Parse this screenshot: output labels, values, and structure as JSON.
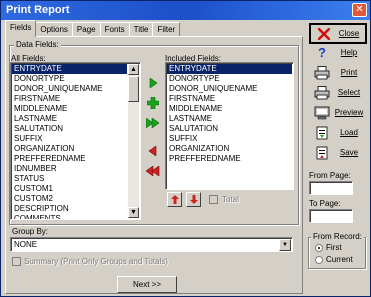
{
  "window": {
    "title": "Print Report",
    "close_glyph": "✕"
  },
  "tabs": [
    {
      "label": "Fields"
    },
    {
      "label": "Options"
    },
    {
      "label": "Page"
    },
    {
      "label": "Fonts"
    },
    {
      "label": "Title"
    },
    {
      "label": "Filter"
    }
  ],
  "data_fields": {
    "group_label": "Data Fields:",
    "all_fields_label": "All Fields:",
    "included_fields_label": "Included Fields:",
    "all_fields": [
      "ENTRYDATE",
      "DONORTYPE",
      "DONOR_UNIQUENAME",
      "FIRSTNAME",
      "MIDDLENAME",
      "LASTNAME",
      "SALUTATION",
      "SUFFIX",
      "ORGANIZATION",
      "PREFFEREDNAME",
      "IDNUMBER",
      "STATUS",
      "CUSTOM1",
      "CUSTOM2",
      "DESCRIPTION",
      "COMMENTS"
    ],
    "included_fields": [
      "ENTRYDATE",
      "DONORTYPE",
      "DONOR_UNIQUENAME",
      "FIRSTNAME",
      "MIDDLENAME",
      "LASTNAME",
      "SALUTATION",
      "SUFFIX",
      "ORGANIZATION",
      "PREFFEREDNAME"
    ],
    "total_label": "Total"
  },
  "group_by": {
    "label": "Group By:",
    "value": "NONE",
    "summary_label": "Summary (Print Only Groups and Totals)"
  },
  "next_button": {
    "label": "Next >>"
  },
  "side_buttons": {
    "close": "Close",
    "help": "Help",
    "print": "Print",
    "select": "Select",
    "preview": "Preview",
    "load": "Load",
    "save": "Save"
  },
  "from_page_label": "From Page:",
  "to_page_label": "To Page:",
  "from_record": {
    "label": "From Record:",
    "options": [
      {
        "label": "First",
        "checked": true
      },
      {
        "label": "Current",
        "checked": false
      }
    ]
  },
  "colors": {
    "selection": "#0a246a",
    "arrow_green": "#1aa31a",
    "arrow_red": "#cc2222",
    "close_red": "#d01010",
    "dialog_bg": "#d4d0c8"
  }
}
